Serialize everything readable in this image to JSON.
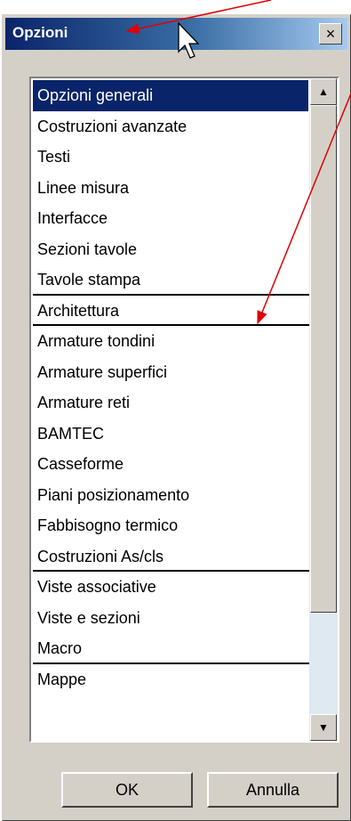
{
  "window": {
    "title": "Opzioni",
    "close_glyph": "×"
  },
  "list": {
    "items": [
      {
        "label": "Opzioni generali",
        "selected": true
      },
      {
        "label": "Costruzioni avanzate"
      },
      {
        "label": "Testi"
      },
      {
        "label": "Linee misura"
      },
      {
        "label": "Interfacce"
      },
      {
        "label": "Sezioni tavole"
      },
      {
        "label": "Tavole stampa",
        "separator_after": true
      },
      {
        "label": "Architettura",
        "separator_after": true
      },
      {
        "label": "Armature tondini"
      },
      {
        "label": "Armature superfici"
      },
      {
        "label": "Armature reti"
      },
      {
        "label": "BAMTEC"
      },
      {
        "label": "Casseforme"
      },
      {
        "label": "Piani posizionamento"
      },
      {
        "label": "Fabbisogno termico"
      },
      {
        "label": "Costruzioni As/cls",
        "separator_after": true
      },
      {
        "label": "Viste associative"
      },
      {
        "label": "Viste e sezioni"
      },
      {
        "label": "Macro",
        "separator_after": true
      },
      {
        "label": "Mappe"
      }
    ]
  },
  "scrollbar": {
    "up_glyph": "▲",
    "down_glyph": "▼"
  },
  "buttons": {
    "ok_label": "OK",
    "cancel_label": "Annulla"
  },
  "colors": {
    "title_start": "#0a246a",
    "title_end": "#a6caf0",
    "selection": "#0a246a",
    "annotation_arrow": "#e00000",
    "dialog_face": "#d4d0c8"
  },
  "annotations": {
    "icons": [
      "mouse-cursor-icon",
      "red-arrow-icon"
    ]
  }
}
